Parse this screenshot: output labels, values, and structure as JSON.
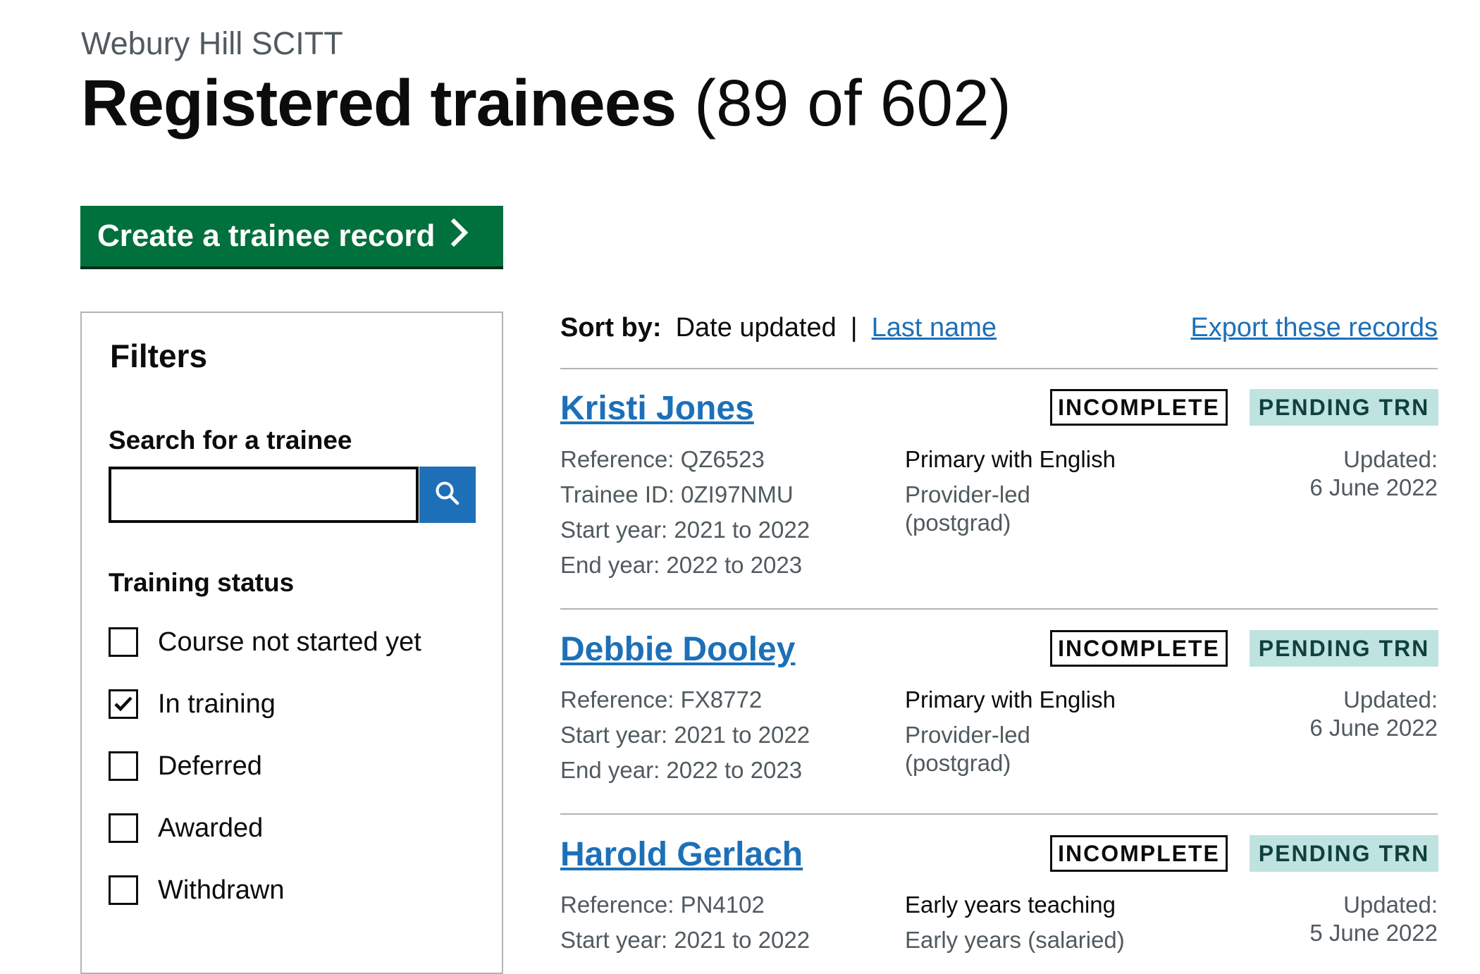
{
  "header": {
    "organisation": "Webury Hill SCITT",
    "title": "Registered trainees",
    "count": "(89 of 602)"
  },
  "actions": {
    "create_label": "Create a trainee record"
  },
  "filters": {
    "title": "Filters",
    "search_label": "Search for a trainee",
    "search_value": "",
    "status_legend": "Training status",
    "statuses": [
      {
        "label": "Course not started yet",
        "checked": false
      },
      {
        "label": "In training",
        "checked": true
      },
      {
        "label": "Deferred",
        "checked": false
      },
      {
        "label": "Awarded",
        "checked": false
      },
      {
        "label": "Withdrawn",
        "checked": false
      }
    ]
  },
  "sort": {
    "label": "Sort by:",
    "current": "Date updated",
    "separator": "|",
    "alternative": "Last name",
    "export_label": "Export these records"
  },
  "colors": {
    "primary_button": "#00703c",
    "link": "#1d70b8",
    "pending_tag_bg": "#bfe3e0",
    "pending_tag_text": "#10403c"
  },
  "trainees": [
    {
      "name": "Kristi Jones",
      "tags": [
        "INCOMPLETE",
        "PENDING TRN"
      ],
      "meta": [
        "Reference: QZ6523",
        "Trainee ID: 0ZI97NMU",
        "Start year: 2021 to 2022",
        "End year: 2022 to 2023"
      ],
      "course_title": "Primary with English",
      "course_route_1": "Provider-led",
      "course_route_2": "(postgrad)",
      "updated_label": "Updated:",
      "updated_date": "6 June 2022"
    },
    {
      "name": "Debbie Dooley",
      "tags": [
        "INCOMPLETE",
        "PENDING TRN"
      ],
      "meta": [
        "Reference: FX8772",
        "Start year: 2021 to 2022",
        "End year: 2022 to 2023"
      ],
      "course_title": "Primary with English",
      "course_route_1": "Provider-led",
      "course_route_2": "(postgrad)",
      "updated_label": "Updated:",
      "updated_date": "6 June 2022"
    },
    {
      "name": "Harold Gerlach",
      "tags": [
        "INCOMPLETE",
        "PENDING TRN"
      ],
      "meta": [
        "Reference: PN4102",
        "Start year: 2021 to 2022"
      ],
      "course_title": "Early years teaching",
      "course_route_1": "Early years (salaried)",
      "course_route_2": "",
      "updated_label": "Updated:",
      "updated_date": "5 June 2022"
    }
  ]
}
